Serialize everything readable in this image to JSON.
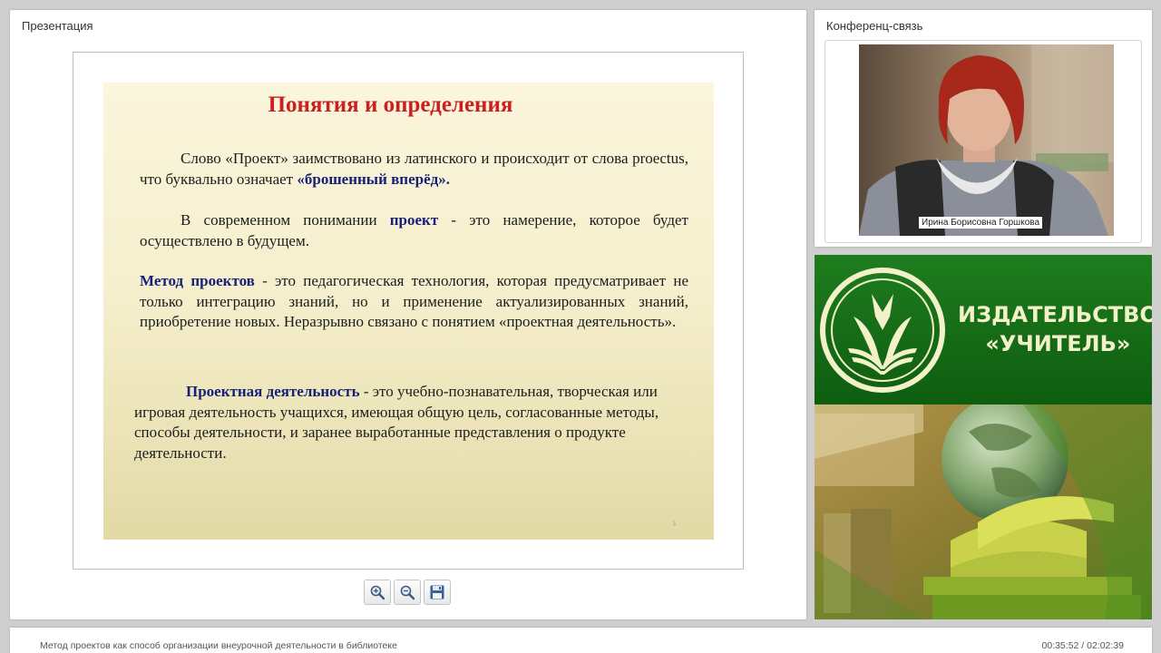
{
  "presentation": {
    "panel_title": "Презентация",
    "slide": {
      "title": "Понятия и определения",
      "p1_text": "Слово «Проект» заимствовано из латинского и происходит от слова proectus, что буквально означает ",
      "p1_highlight": "«брошенный вперёд».",
      "p2_pre": "В современном понимании ",
      "p2_highlight": "проект",
      "p2_post": " - это намерение, которое будет осуществлено в будущем.",
      "p3_highlight": "Метод проектов",
      "p3_post": " - это педагогическая технология, которая предусматривает не только интеграцию знаний, но и применение актуализированных знаний, приобретение новых. Неразрывно связано с понятием «проектная деятельность».",
      "p4_highlight": "Проектная деятельность",
      "p4_post": " - это учебно-познавательная, творческая или игровая деятельность учащихся, имеющая общую цель, согласованные методы, способы деятельности, и заранее выработанные представления о продукте деятельности.",
      "page_number": "3"
    },
    "toolbar": {
      "zoom_in_icon": "zoom-in-icon",
      "zoom_out_icon": "zoom-out-icon",
      "save_icon": "floppy-disk-icon"
    }
  },
  "conference": {
    "panel_title": "Конференц-связь",
    "speaker_name": "Ирина Борисовна Горшкова"
  },
  "banner": {
    "line1": "ИЗДАТЕЛЬСТВО",
    "line2": "«УЧИТЕЛЬ»",
    "brand_color": "#1a7a1a",
    "text_color": "#f3f1c9"
  },
  "footer": {
    "title": "Метод проектов как способ организации внеурочной деятельности в библиотеке",
    "time": "00:35:52 / 02:02:39"
  }
}
